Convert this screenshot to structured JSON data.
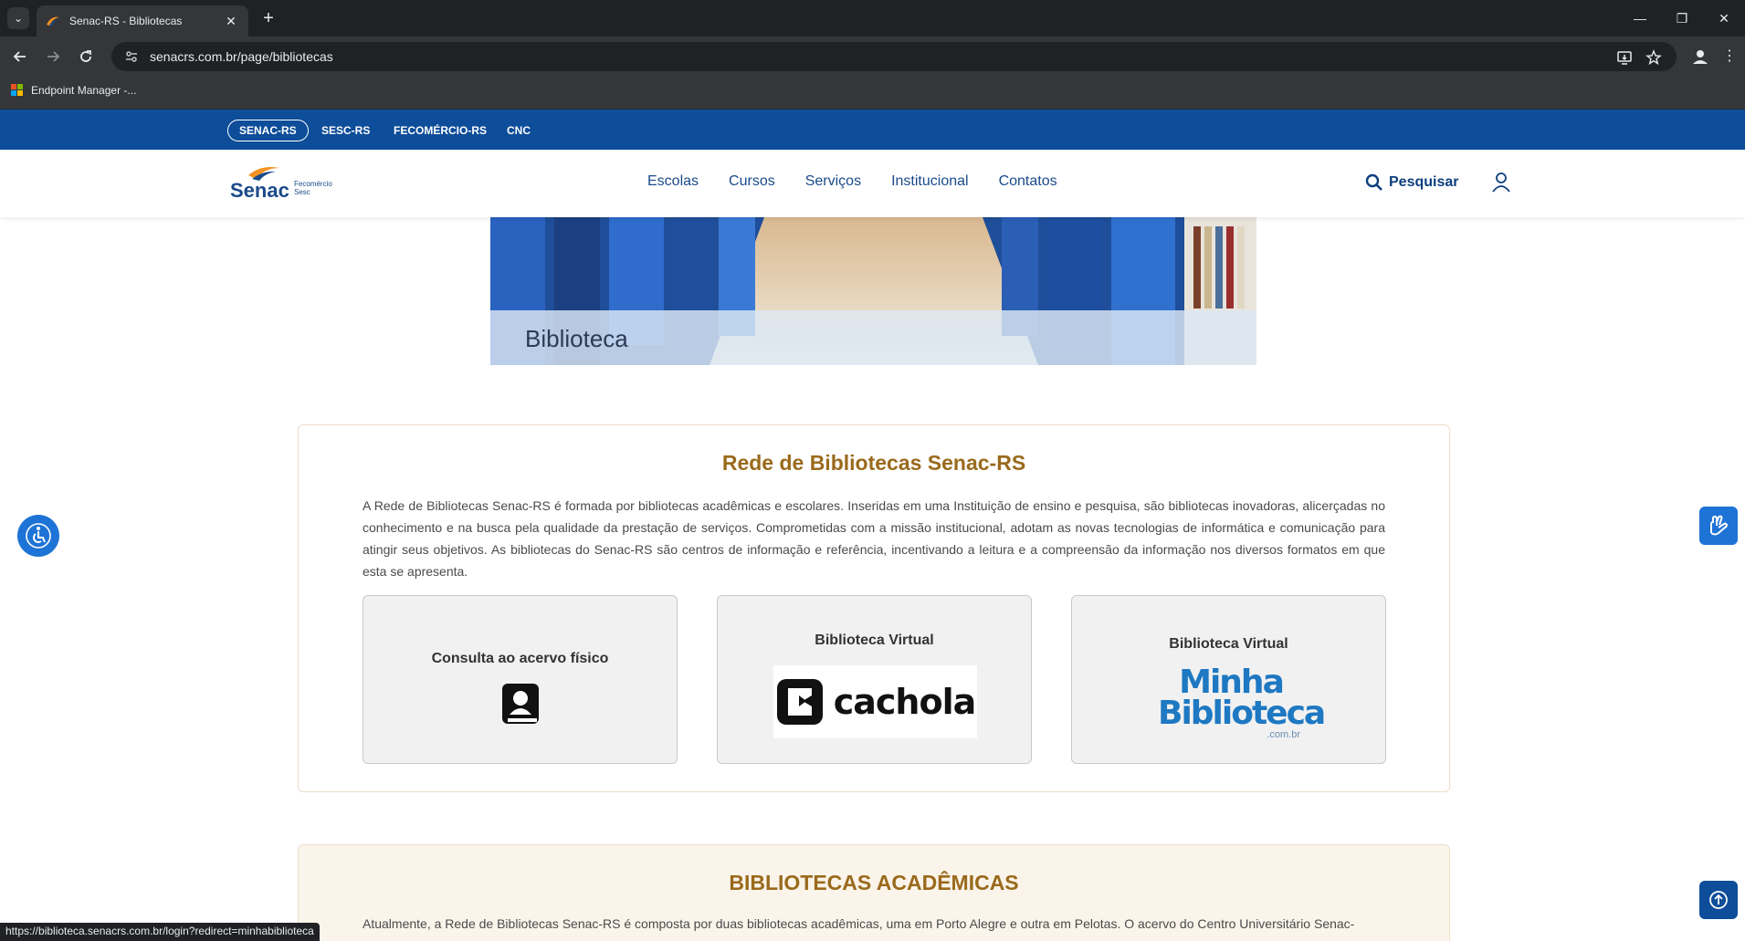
{
  "browser": {
    "tab_title": "Senac-RS - Bibliotecas",
    "url": "senacrs.com.br/page/bibliotecas",
    "bookmark_label": "Endpoint Manager -...",
    "status_url": "https://biblioteca.senacrs.com.br/login?redirect=minhabiblioteca"
  },
  "institutions": [
    "SENAC-RS",
    "SESC-RS",
    "FECOMÉRCIO-RS",
    "CNC"
  ],
  "header": {
    "logo_word": "Senac",
    "logo_sub_1": "Fecomércio",
    "logo_sub_2": "Sesc",
    "nav": [
      "Escolas",
      "Cursos",
      "Serviços",
      "Institucional",
      "Contatos"
    ],
    "search_label": "Pesquisar"
  },
  "banner": {
    "title": "Biblioteca"
  },
  "network": {
    "title": "Rede de Bibliotecas Senac-RS",
    "text": "A Rede de Bibliotecas Senac-RS é formada por bibliotecas acadêmicas e escolares. Inseridas em uma Instituição de ensino e pesquisa, são bibliotecas inovadoras, alicerçadas no conhecimento e na busca pela qualidade da prestação de serviços. Comprometidas com a missão institucional, adotam as novas tecnologias de informática e comunicação para atingir seus objetivos. As bibliotecas do Senac-RS são centros de informação e referência, incentivando a leitura e a compreensão da informação nos diversos formatos em que esta se apresenta.",
    "tiles": [
      {
        "label": "Consulta ao acervo físico",
        "icon": "book-icon"
      },
      {
        "label": "Biblioteca Virtual",
        "logo_text": "cachola"
      },
      {
        "label": "Biblioteca Virtual",
        "logo_line_1": "Minha",
        "logo_line_2": "Biblioteca",
        "logo_suffix": ".com.br"
      }
    ]
  },
  "academic": {
    "title": "BIBLIOTECAS ACADÊMICAS",
    "text": "Atualmente, a Rede de Bibliotecas Senac-RS é composta por duas bibliotecas acadêmicas, uma em Porto Alegre e outra em Pelotas. O acervo do Centro Universitário Senac-"
  },
  "colors": {
    "brand_blue": "#0d4d99",
    "section_title": "#9a6a1c",
    "widget_blue": "#1e73d6"
  }
}
